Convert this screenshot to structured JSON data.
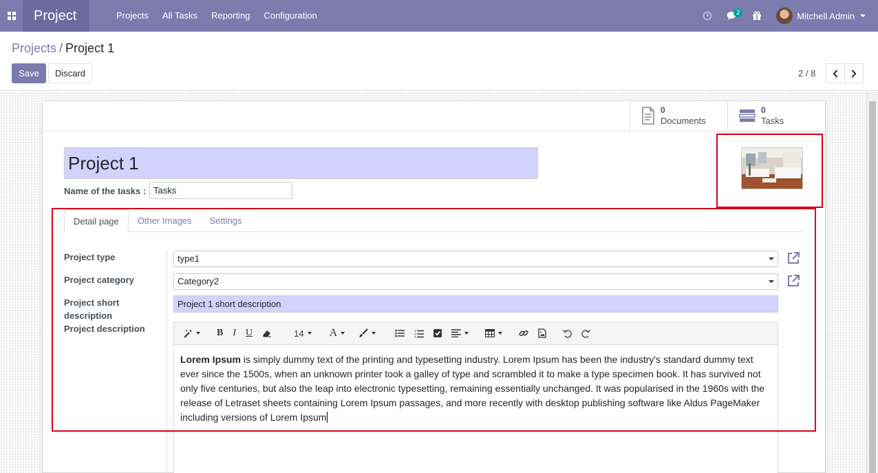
{
  "navbar": {
    "app_name": "Project",
    "menu": [
      "Projects",
      "All Tasks",
      "Reporting",
      "Configuration"
    ],
    "message_count": "2",
    "user_name": "Mitchell Admin",
    "brand_color": "#7c7bad"
  },
  "breadcrumb": {
    "parent": "Projects",
    "separator": "/",
    "current": "Project 1"
  },
  "buttons": {
    "save": "Save",
    "discard": "Discard"
  },
  "pager": {
    "value": "2 / 8"
  },
  "smart_buttons": [
    {
      "value": "0",
      "label": "Documents",
      "icon": "document-icon"
    },
    {
      "value": "0",
      "label": "Tasks",
      "icon": "tasks-icon"
    }
  ],
  "form": {
    "name": "Project 1",
    "tasks_label": "Name of the tasks :",
    "tasks_value": "Tasks",
    "tabs": [
      "Detail page",
      "Other Images",
      "Settings"
    ],
    "project_type_label": "Project type",
    "project_type_value": "type1",
    "project_category_label": "Project category",
    "project_category_value": "Category2",
    "short_desc_label": "Project short description",
    "short_desc_value": "Project 1 short description",
    "description_label": "Project description",
    "description_bold": "Lorem Ipsum",
    "description_rest": " is simply dummy text of the printing and typesetting industry. Lorem Ipsum has been the industry's standard dummy text ever since the 1500s, when an unknown printer took a galley of type and scrambled it to make a type specimen book. It has survived not only five centuries, but also the leap into electronic typesetting, remaining essentially unchanged. It was popularised in the 1960s with the release of Letraset sheets containing Lorem Ipsum passages, and more recently with desktop publishing software like Aldus PageMaker including versions of Lorem Ipsum"
  },
  "editor_toolbar": {
    "font_size": "14"
  },
  "annotation_color": "#d6001c"
}
